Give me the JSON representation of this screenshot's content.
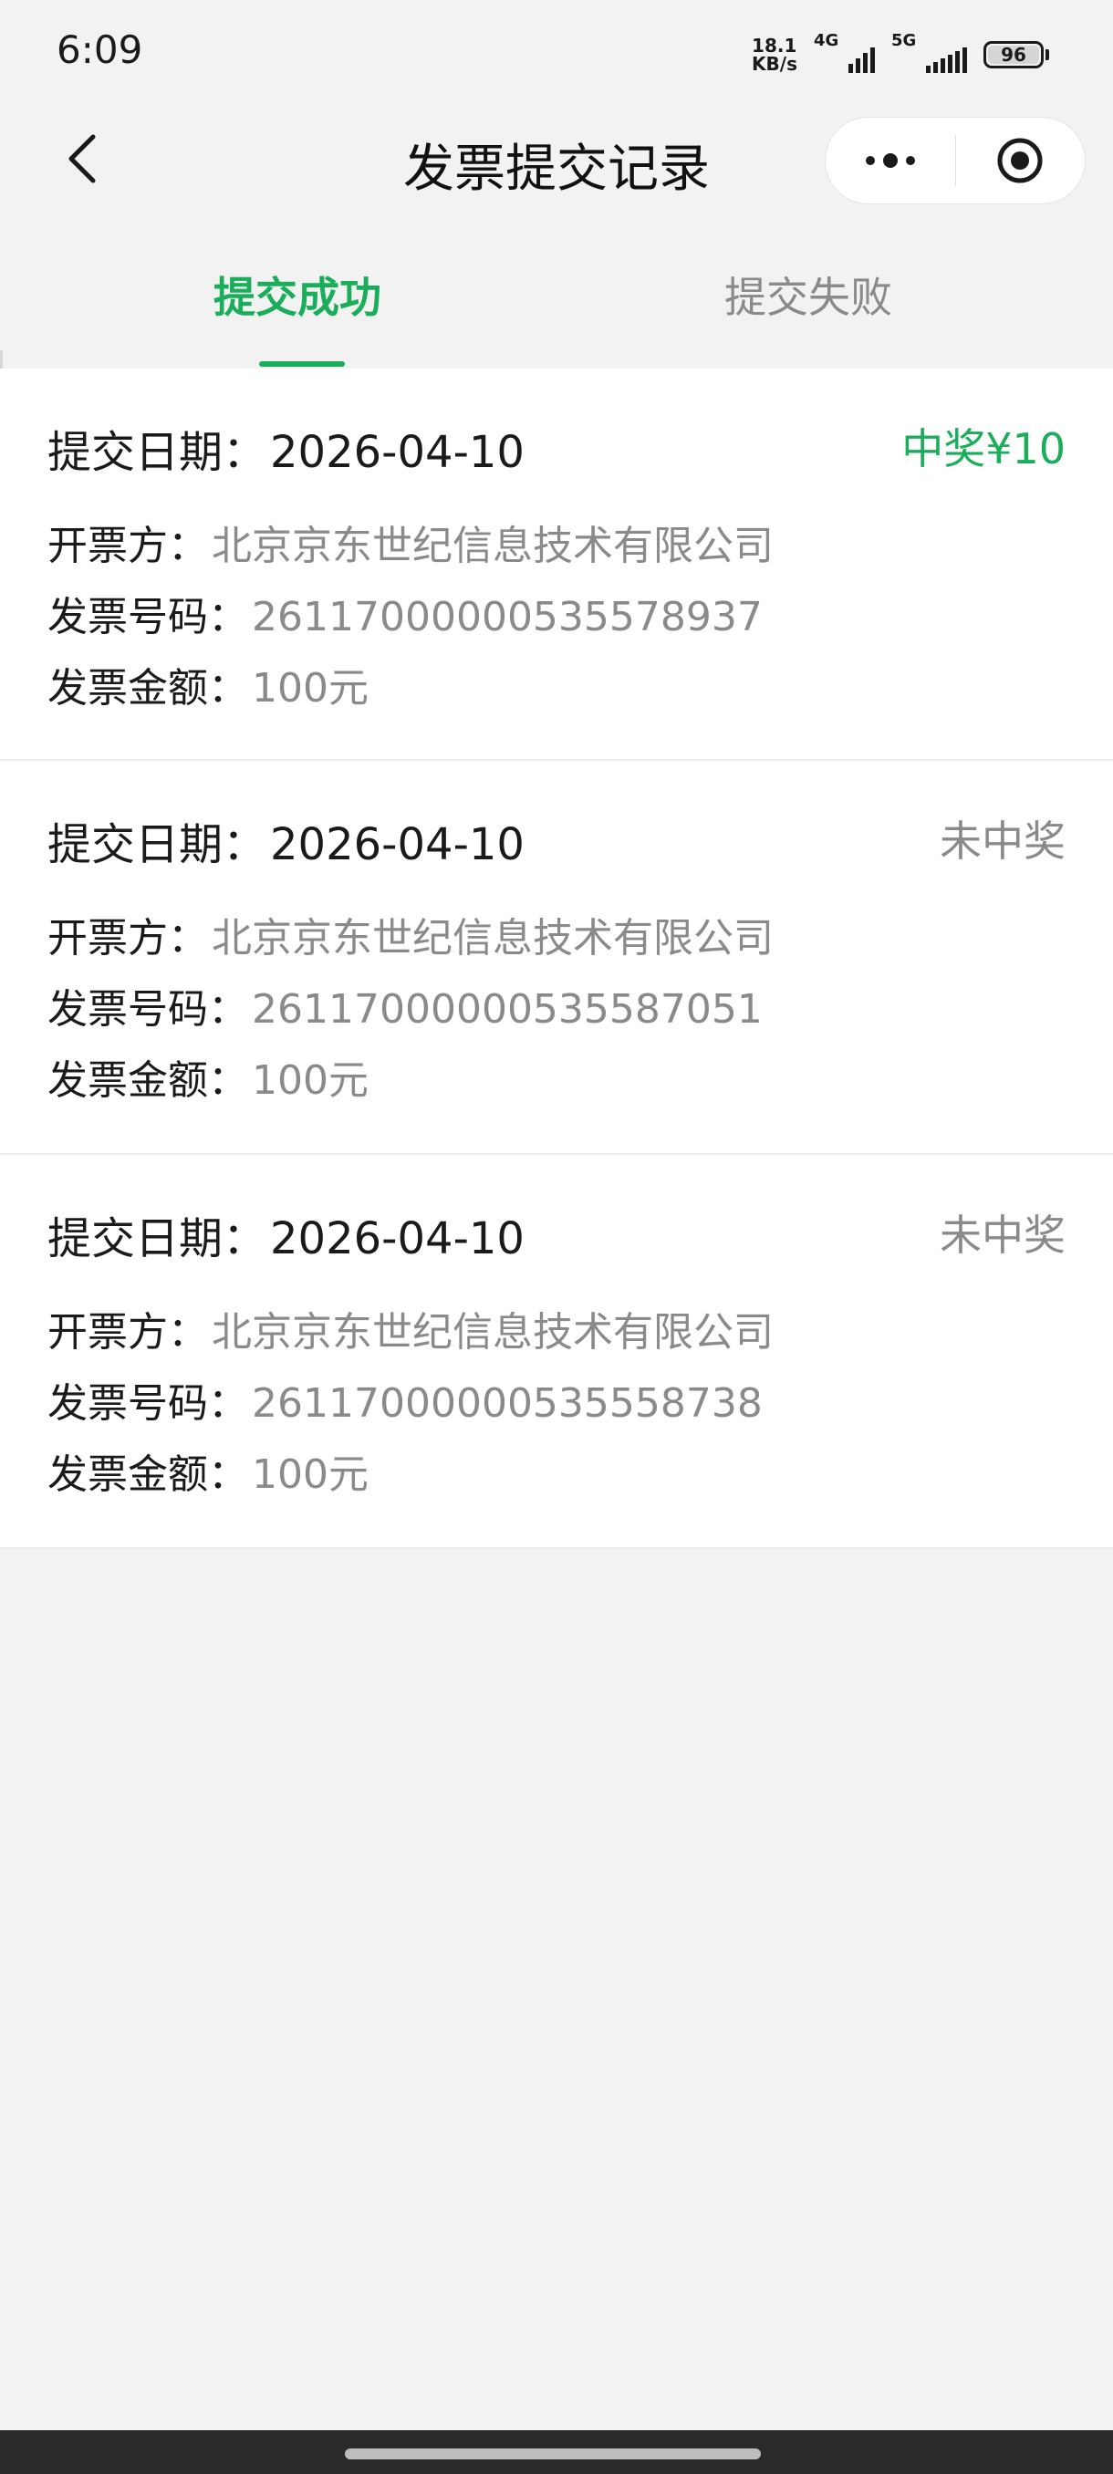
{
  "status_bar": {
    "time": "6:09",
    "net_speed_value": "18.1",
    "net_speed_unit": "KB/s",
    "sim1_label": "4G",
    "sim2_label": "5G",
    "battery": "96"
  },
  "nav": {
    "title": "发票提交记录",
    "back_icon": "chevron-left-icon",
    "more_icon": "more-dots-icon",
    "close_icon": "target-circle-icon"
  },
  "tabs": [
    {
      "label": "提交成功",
      "active": true
    },
    {
      "label": "提交失败",
      "active": false
    }
  ],
  "labels": {
    "date": "提交日期：",
    "issuer": "开票方：",
    "number": "发票号码：",
    "amount": "发票金额："
  },
  "records": [
    {
      "date": "2026-04-10",
      "status": "中奖¥10",
      "won": true,
      "issuer": "北京京东世纪信息技术有限公司",
      "number": "26117000000535578937",
      "amount": "100元"
    },
    {
      "date": "2026-04-10",
      "status": "未中奖",
      "won": false,
      "issuer": "北京京东世纪信息技术有限公司",
      "number": "26117000000535587051",
      "amount": "100元"
    },
    {
      "date": "2026-04-10",
      "status": "未中奖",
      "won": false,
      "issuer": "北京京东世纪信息技术有限公司",
      "number": "26117000000535558738",
      "amount": "100元"
    }
  ],
  "colors": {
    "accent": "#1aad5a",
    "muted": "#8a8a8a",
    "background": "#f2f2f2"
  }
}
